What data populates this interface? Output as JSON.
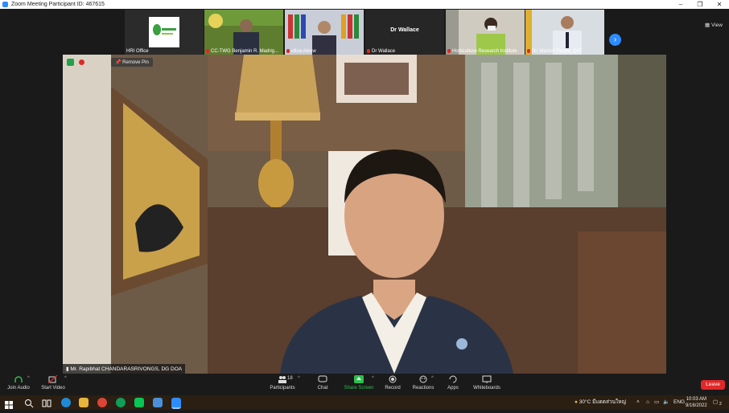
{
  "window": {
    "title": "Zoom Meeting Participant ID: 467615"
  },
  "view_label": "View",
  "participants": [
    {
      "name": "HRI Office"
    },
    {
      "name": "CC-TWG Benjamin R. Madrig..."
    },
    {
      "name": "efina Alouw"
    },
    {
      "name": "Dr Wallace",
      "center_text": "Dr Wallace"
    },
    {
      "name": "Horticulture Research Institute"
    },
    {
      "name": "Dr. Manish Pande, QCI"
    }
  ],
  "main_video": {
    "remove_pin": "Remove Pin",
    "speaker_name": "Mr. Rapibhat CHANDARASRIVONGS, DG DOA"
  },
  "toolbar": {
    "join_audio": "Join Audio",
    "start_video": "Start Video",
    "participants": "Participants",
    "participants_count": "18",
    "chat": "Chat",
    "share_screen": "Share Screen",
    "record": "Record",
    "reactions": "Reactions",
    "apps": "Apps",
    "whiteboards": "Whiteboards",
    "leave": "Leave"
  },
  "taskbar": {
    "weather": "30°C มีแดดส่วนใหญ่",
    "lang": "ENG",
    "time": "10:03 AM",
    "date": "9/16/2022",
    "notifications": "2"
  }
}
